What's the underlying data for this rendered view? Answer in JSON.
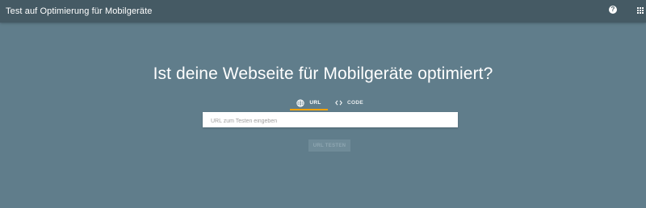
{
  "header": {
    "title": "Test auf Optimierung für Mobilgeräte",
    "help_icon": "help-circle-icon",
    "apps_icon": "apps-grid-icon"
  },
  "main": {
    "headline": "Ist deine Webseite für Mobilgeräte optimiert?",
    "tabs": [
      {
        "label": "URL",
        "icon": "globe-icon",
        "selected": true
      },
      {
        "label": "CODE",
        "icon": "code-brackets-icon",
        "selected": false
      }
    ],
    "url_input": {
      "placeholder": "URL zum Testen eingeben",
      "value": ""
    },
    "submit_label": "URL TESTEN"
  },
  "colors": {
    "page_background": "#607d8b",
    "header_background": "#455a64",
    "tab_indicator": "#f4a300",
    "button_disabled": "#6f8b98"
  }
}
